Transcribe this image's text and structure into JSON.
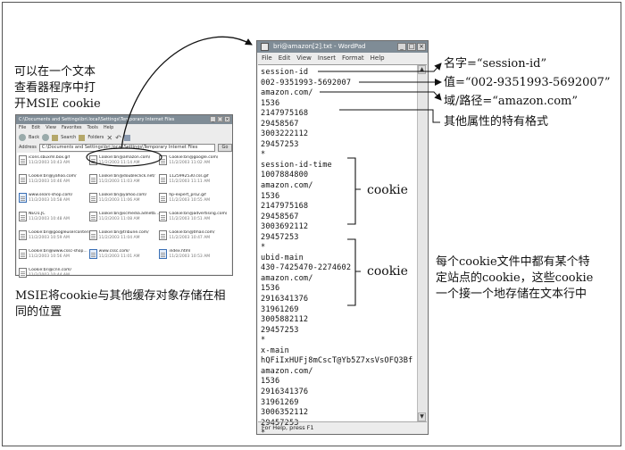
{
  "explorer": {
    "title": "C:\\Documents and Settings\\bri.local\\Settings\\Temporary Internet Files",
    "menu": [
      "File",
      "Edit",
      "View",
      "Favorites",
      "Tools",
      "Help"
    ],
    "toolbar": [
      "Back",
      "Search",
      "Folders"
    ],
    "address_label": "Address",
    "address_value": "C:\\Documents and Settings\\bri.local\\Settings\\Temporary Internet Files",
    "go_label": "Go",
    "files": [
      {
        "name": "icons.sbuxml.box.gif",
        "date": "11/2/2003 10:43 AM",
        "ie": false
      },
      {
        "name": "Cookie:bri@amazon.com/",
        "date": "11/2/2003 11:14 AM",
        "ie": false
      },
      {
        "name": "Cookie:bri@google.com/",
        "date": "11/2/2003 11:02 AM",
        "ie": false
      },
      {
        "name": "Cookie:bri@yahoo.com/",
        "date": "11/2/2003 10:46 AM",
        "ie": false
      },
      {
        "name": "Cookie:bri@doubleclick.net/",
        "date": "11/2/2003 11:03 AM",
        "ie": false
      },
      {
        "name": "1125992530.css.gif",
        "date": "11/2/2003 11:11 AM",
        "ie": false
      },
      {
        "name": "www.sears-shop.com/",
        "date": "11/2/2003 10:58 AM",
        "ie": true
      },
      {
        "name": "Cookie:bri@yahoo.com/",
        "date": "11/2/2003 11:06 AM",
        "ie": false
      },
      {
        "name": "hp-expert_pro2.gif",
        "date": "11/2/2003 10:55 AM",
        "ie": false
      },
      {
        "name": "NEO1.JC",
        "date": "11/2/2003 10:48 AM",
        "ie": false
      },
      {
        "name": "Cookie:bri@scmedia.adnetb...",
        "date": "11/2/2003 11:08 AM",
        "ie": false
      },
      {
        "name": "Cookie:bri@advertising.com/",
        "date": "11/2/2003 10:51 AM",
        "ie": false
      },
      {
        "name": "Cookie:bri@googleusercontent/",
        "date": "11/2/2003 10:59 AM",
        "ie": false
      },
      {
        "name": "Cookie:bri@tribune.com/",
        "date": "11/2/2003 11:04 AM",
        "ie": false
      },
      {
        "name": "Cookie:bri@tmail.com/",
        "date": "11/2/2003 10:47 AM",
        "ie": false
      },
      {
        "name": "Cookie:bri@www.cssc-shop...",
        "date": "11/2/2003 10:56 AM",
        "ie": false
      },
      {
        "name": "www.cssc.com/",
        "date": "11/2/2003 11:01 AM",
        "ie": true
      },
      {
        "name": "index.html",
        "date": "11/2/2003 10:53 AM",
        "ie": true
      },
      {
        "name": "Cookie:bri@cnn.com/",
        "date": "11/2/2003 10:44 AM",
        "ie": false
      }
    ]
  },
  "wordpad": {
    "title": "bri@amazon[2].txt - WordPad",
    "menu": [
      "File",
      "Edit",
      "View",
      "Insert",
      "Format",
      "Help"
    ],
    "lines": [
      "session-id",
      "002-9351993-5692007",
      "amazon.com/",
      "1536",
      "2147975168",
      "29458567",
      "3003222112",
      "29457253",
      "*",
      "session-id-time",
      "1007884800",
      "amazon.com/",
      "1536",
      "2147975168",
      "29458567",
      "3003692112",
      "29457253",
      "*",
      "ubid-main",
      "430-7425470-2274602",
      "amazon.com/",
      "1536",
      "2916341376",
      "31961269",
      "3005882112",
      "29457253",
      "*",
      "x-main",
      "hQFiIxHUFj8mCscT@Yb5Z7xsVsOFQ3Bf",
      "amazon.com/",
      "1536",
      "2916341376",
      "31961269",
      "3006352112",
      "29457253",
      "*"
    ],
    "status": "For Help, press F1"
  },
  "annotations": {
    "open_note": [
      "可以在一个文本",
      "查看器程序中打",
      "开MSIE cookie"
    ],
    "store_note": [
      "MSIE将cookie与其他缓存对象存储在相",
      "同的位置"
    ],
    "name_label": "名字=“session-id”",
    "value_label": "值=“002-9351993-5692007”",
    "domain_label": "域/路径=“amazon.com”",
    "attr_label": "其他属性的特有格式",
    "cookie_label_1": "cookie",
    "cookie_label_2": "cookie",
    "per_file_note": [
      "每个cookie文件中都有某个特",
      "定站点的cookie，这些cookie",
      "一个接一个地存储在文本行中"
    ]
  }
}
